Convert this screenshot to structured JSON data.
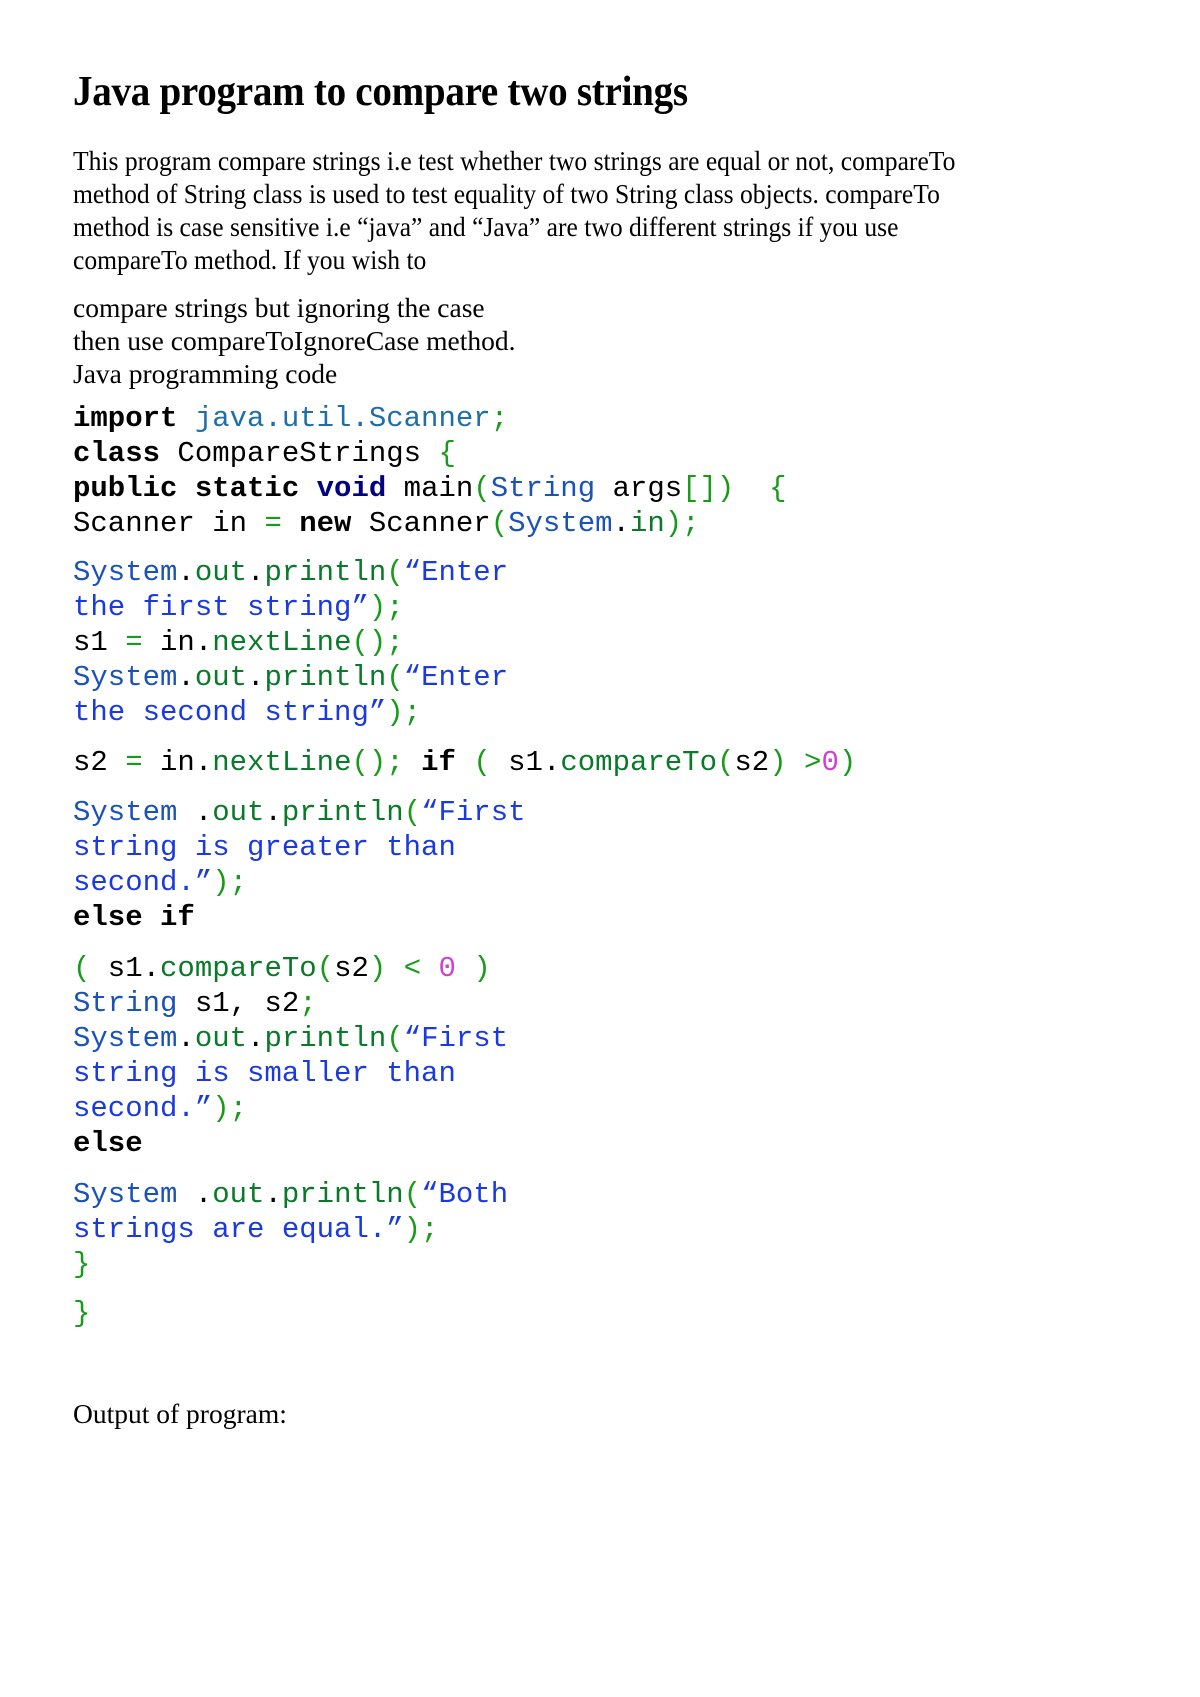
{
  "document": {
    "title": "Java program to compare two strings",
    "intro_lines": [
      "This program compare strings i.e test whether two strings are equal or not, compareTo",
      "method of String class is used to test equality of two String class objects. compareTo",
      "method is case sensitive i.e “java” and “Java” are two different strings if you use",
      "compareTo method. If you wish to"
    ],
    "second_para_lines": [
      "compare strings but ignoring the case",
      "then use compareToIgnoreCase method.",
      "Java programming code"
    ],
    "code": {
      "l1": {
        "t1": "import",
        "t2": " java.util.Scanner",
        "t3": ";"
      },
      "l2": {
        "t1": "class",
        "t2": " CompareStrings ",
        "t3": "{"
      },
      "l3": {
        "t1": "public static ",
        "t2": "void",
        "t3": " main",
        "t4": "(",
        "t5": "String",
        "t6": " args",
        "t7": "[])",
        "t8": "  {"
      },
      "l4": {
        "t1": "Scanner in ",
        "t2": "=",
        "t3": " new",
        "t4": " Scanner",
        "t5": "(",
        "t6": "System",
        "t7": ".",
        "t8": "in",
        "t9": ");"
      },
      "l5": {
        "t1": "System",
        "t2": ".",
        "t3": "out",
        "t4": ".",
        "t5": "println",
        "t6": "(",
        "t7": "“Enter"
      },
      "l6": {
        "t1": "the first string”",
        "t2": ");"
      },
      "l7": {
        "t1": "s1 ",
        "t2": "=",
        "t3": " in",
        "t4": ".",
        "t5": "nextLine",
        "t6": "();"
      },
      "l8": {
        "t1": "System",
        "t2": ".",
        "t3": "out",
        "t4": ".",
        "t5": "println",
        "t6": "(",
        "t7": "“Enter"
      },
      "l9": {
        "t1": "the second string”",
        "t2": ");"
      },
      "l10": {
        "t1": "s2 ",
        "t2": "=",
        "t3": " in",
        "t4": ".",
        "t5": "nextLine",
        "t6": "();",
        "t7": " if",
        "t8": " (",
        "t9": " s1",
        "t10": ".",
        "t11": "compareTo",
        "t12": "(",
        "t13": "s2",
        "t14": ")",
        "t15": " >",
        "t16": "0",
        "t17": ")"
      },
      "l11": {
        "t1": "System",
        "t2": " .",
        "t3": "out",
        "t4": ".",
        "t5": "println",
        "t6": "(",
        "t7": "“First"
      },
      "l12": {
        "t1": "string is greater than"
      },
      "l13": {
        "t1": "second.”",
        "t2": ");"
      },
      "l14": {
        "t1": "else if"
      },
      "l15": {
        "t1": "(",
        "t2": " s1",
        "t3": ".",
        "t4": "compareTo",
        "t5": "(",
        "t6": "s2",
        "t7": ")",
        "t8": " <",
        "t9": " 0",
        "t10": " )"
      },
      "l16": {
        "t1": "String",
        "t2": " s1, s2",
        "t3": ";"
      },
      "l17": {
        "t1": "System",
        "t2": ".",
        "t3": "out",
        "t4": ".",
        "t5": "println",
        "t6": "(",
        "t7": "“First"
      },
      "l18": {
        "t1": "string is smaller than"
      },
      "l19": {
        "t1": "second.”",
        "t2": ");"
      },
      "l20": {
        "t1": "else"
      },
      "l21": {
        "t1": "System",
        "t2": " .",
        "t3": "out",
        "t4": ".",
        "t5": "println",
        "t6": "(",
        "t7": "“Both"
      },
      "l22": {
        "t1": "strings are equal.”",
        "t2": ");"
      },
      "l23": {
        "t1": "}"
      },
      "l24": {
        "t1": "}"
      }
    },
    "output_label": "Output of program:"
  }
}
